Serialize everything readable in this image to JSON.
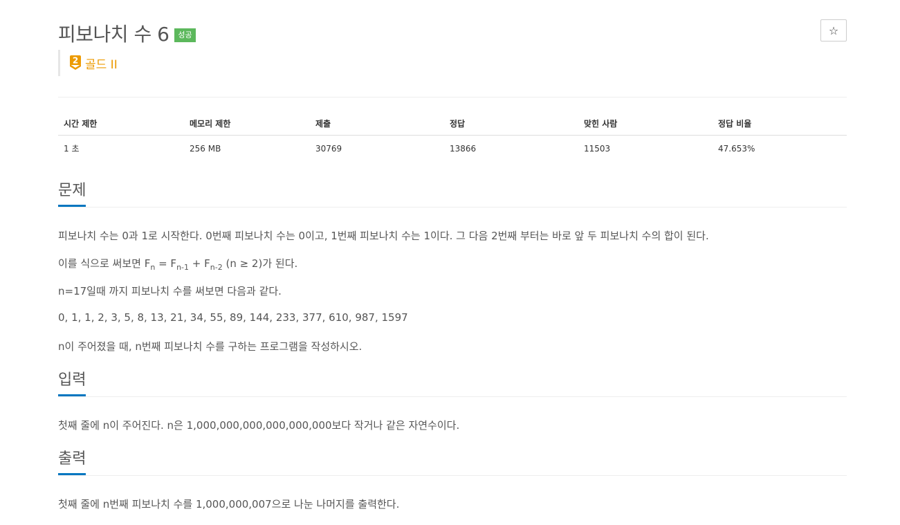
{
  "problem": {
    "title": "피보나치 수 6",
    "status_badge": "성공",
    "tier_number": "2",
    "tier_label": "골드 II",
    "star_icon": "☆"
  },
  "stats": {
    "headers": [
      "시간 제한",
      "메모리 제한",
      "제출",
      "정답",
      "맞힌 사람",
      "정답 비율"
    ],
    "values": [
      "1 초",
      "256 MB",
      "30769",
      "13866",
      "11503",
      "47.653%"
    ]
  },
  "sections": {
    "description": {
      "title": "문제",
      "p1": "피보나치 수는 0과 1로 시작한다. 0번째 피보나치 수는 0이고, 1번째 피보나치 수는 1이다. 그 다음 2번째 부터는 바로 앞 두 피보나치 수의 합이 된다.",
      "p2_prefix": "이를 식으로 써보면 F",
      "p2_sub1": "n",
      "p2_mid1": " = F",
      "p2_sub2": "n-1",
      "p2_mid2": " + F",
      "p2_sub3": "n-2",
      "p2_suffix": " (n ≥ 2)가 된다.",
      "p3": "n=17일때 까지 피보나치 수를 써보면 다음과 같다.",
      "p4": "0, 1, 1, 2, 3, 5, 8, 13, 21, 34, 55, 89, 144, 233, 377, 610, 987, 1597",
      "p5": "n이 주어졌을 때, n번째 피보나치 수를 구하는 프로그램을 작성하시오."
    },
    "input": {
      "title": "입력",
      "text": "첫째 줄에 n이 주어진다. n은 1,000,000,000,000,000,000보다 작거나 같은 자연수이다."
    },
    "output": {
      "title": "출력",
      "text": "첫째 줄에 n번째 피보나치 수를 1,000,000,007으로 나눈 나머지를 출력한다."
    }
  },
  "colors": {
    "tier_gold": "#ec9a00",
    "success_green": "#5cb85c",
    "section_underline": "#0076c0"
  }
}
